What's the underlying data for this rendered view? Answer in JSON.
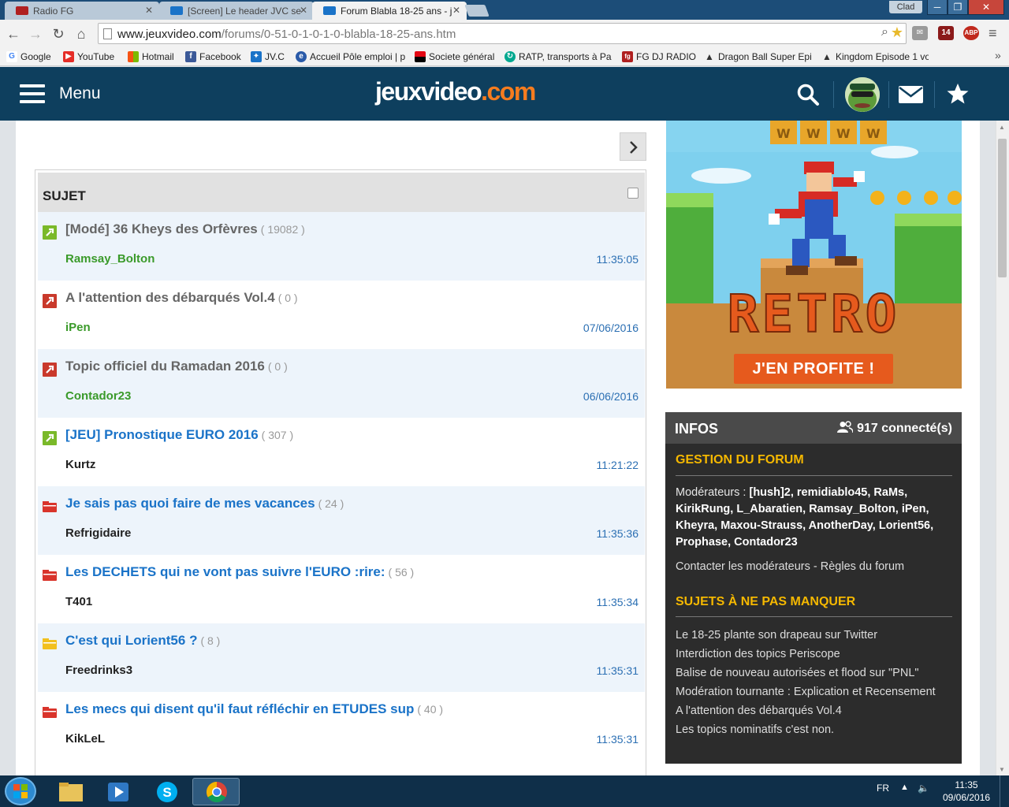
{
  "browser": {
    "tabs": [
      {
        "title": "Radio FG",
        "favicon_color": "#b02020"
      },
      {
        "title": "[Screen] Le header JVC se",
        "favicon_color": "#1a73c8"
      },
      {
        "title": "Forum Blabla 18-25 ans - j",
        "favicon_color": "#1a73c8"
      }
    ],
    "user": "Clad",
    "url_host": "www.jeuxvideo.com",
    "url_path": "/forums/0-51-0-1-0-1-0-blabla-18-25-ans.htm",
    "extensions": [
      {
        "label": "",
        "color": "#9a9a9a"
      },
      {
        "label": "14",
        "color": "#8b1a1a"
      },
      {
        "label": "ABP",
        "color": "#c0281c"
      }
    ],
    "bookmarks": [
      {
        "label": "Google",
        "icon": "G",
        "color": "#4285f4"
      },
      {
        "label": "YouTube",
        "icon": "▶",
        "color": "#e52d27"
      },
      {
        "label": "Hotmail",
        "icon": "■",
        "color": "#f65314"
      },
      {
        "label": "Facebook",
        "icon": "f",
        "color": "#3b5998"
      },
      {
        "label": "JV.C",
        "icon": "✦",
        "color": "#1a73c8"
      },
      {
        "label": "Accueil Pôle emploi | p",
        "icon": "e",
        "color": "#2a5aa8"
      },
      {
        "label": "Societe général",
        "icon": "■",
        "color": "#e30613"
      },
      {
        "label": "RATP, transports à Par",
        "icon": "↻",
        "color": "#00a88f"
      },
      {
        "label": "FG DJ RADIO",
        "icon": "fg",
        "color": "#b02020"
      },
      {
        "label": "Dragon Ball Super Epi",
        "icon": "▲",
        "color": "#333333"
      },
      {
        "label": "Kingdom Episode 1 vo",
        "icon": "▲",
        "color": "#333333"
      }
    ]
  },
  "site": {
    "menu_label": "Menu",
    "logo_main": "jeuxvideo",
    "logo_dot": ".com",
    "brand_color": "#0e3f5e",
    "accent_color": "#f57c1f"
  },
  "forum": {
    "header_label": "SUJET",
    "topics": [
      {
        "title": "[Modé] 36 Kheys des Orfèvres",
        "count": "( 19082 )",
        "author": "Ramsay_Bolton",
        "time": "11:35:05",
        "icon": "pin-green",
        "style": "pinned",
        "author_style": "green"
      },
      {
        "title": "A l'attention des débarqués Vol.4",
        "count": "( 0 )",
        "author": "iPen",
        "time": "07/06/2016",
        "icon": "pin-red",
        "style": "pinned",
        "author_style": "green"
      },
      {
        "title": "Topic officiel du Ramadan 2016",
        "count": "( 0 )",
        "author": "Contador23",
        "time": "06/06/2016",
        "icon": "pin-red",
        "style": "pinned",
        "author_style": "green"
      },
      {
        "title": "[JEU] Pronostique EURO 2016",
        "count": "( 307 )",
        "author": "Kurtz",
        "time": "11:21:22",
        "icon": "pin-green",
        "style": "link",
        "author_style": "dark"
      },
      {
        "title": "Je sais pas quoi faire de mes vacances",
        "count": "( 24 )",
        "author": "Refrigidaire",
        "time": "11:35:36",
        "icon": "folder-red",
        "style": "link",
        "author_style": "dark"
      },
      {
        "title": "Les DECHETS qui ne vont pas suivre l'EURO :rire:",
        "count": "( 56 )",
        "author": "T401",
        "time": "11:35:34",
        "icon": "folder-red",
        "style": "link",
        "author_style": "dark"
      },
      {
        "title": "C'est qui Lorient56 ?",
        "count": "( 8 )",
        "author": "Freedrinks3",
        "time": "11:35:31",
        "icon": "folder-yellow",
        "style": "link",
        "author_style": "dark"
      },
      {
        "title": "Les mecs qui disent qu'il faut réfléchir en ETUDES sup",
        "count": "( 40 )",
        "author": "KikLeL",
        "time": "11:35:31",
        "icon": "folder-red",
        "style": "link",
        "author_style": "dark"
      }
    ]
  },
  "ad": {
    "headline": "RETRO",
    "cta": "J'EN PROFITE !"
  },
  "infos": {
    "title": "INFOS",
    "connected": "917 connecté(s)",
    "gestion_title": "GESTION DU FORUM",
    "moderators_label": "Modérateurs : ",
    "moderators": "[hush]2, remidiablo45, RaMs, KirikRung, L_Abaratien, Ramsay_Bolton, iPen, Kheyra, Maxou-Strauss, AnotherDay, Lorient56, Prophase, Contador23",
    "contact": "Contacter les modérateurs - Règles du forum",
    "must_title": "SUJETS À NE PAS MANQUER",
    "must_list": [
      "Le 18-25 plante son drapeau sur Twitter",
      "Interdiction des topics Periscope",
      "Balise de nouveau autorisées et flood sur \"PNL\"",
      "Modération tournante : Explication et Recensement",
      "A l'attention des débarqués Vol.4",
      "Les topics nominatifs c'est non."
    ]
  },
  "taskbar": {
    "lang": "FR",
    "time": "11:35",
    "date": "09/06/2016"
  }
}
